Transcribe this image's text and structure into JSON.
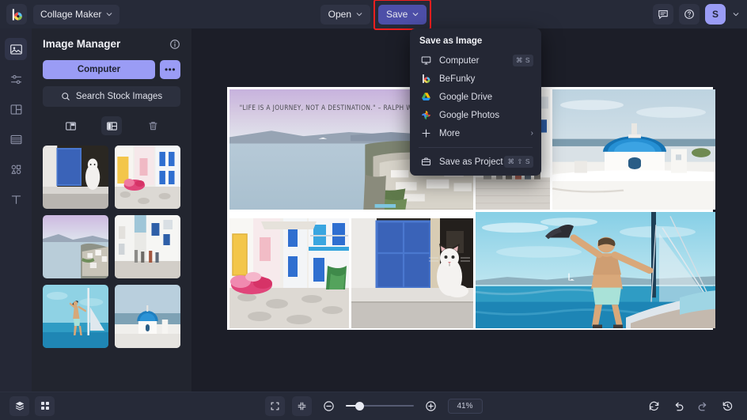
{
  "app": {
    "logo_icon": "befunky-logo-icon",
    "document_title": "Collage Maker",
    "title_chevron_icon": "chevron-down-icon"
  },
  "header": {
    "open_label": "Open",
    "open_chevron_icon": "chevron-down-icon",
    "save_label": "Save",
    "save_chevron_icon": "chevron-down-icon",
    "save_highlight_color": "#f01f1f",
    "save_button_color": "#4d4fa8",
    "feedback_icon": "chat-bubble-icon",
    "help_icon": "question-circle-icon",
    "avatar_initial": "S",
    "avatar_color": "#9a9cf5",
    "avatar_chevron_icon": "chevron-down-icon"
  },
  "save_menu": {
    "title": "Save as Image",
    "items": [
      {
        "label": "Computer",
        "icon": "monitor-icon",
        "shortcut": "⌘ S",
        "arrow": ""
      },
      {
        "label": "BeFunky",
        "icon": "befunky-logo-icon",
        "shortcut": "",
        "arrow": ""
      },
      {
        "label": "Google Drive",
        "icon": "google-drive-icon",
        "shortcut": "",
        "arrow": ""
      },
      {
        "label": "Google Photos",
        "icon": "google-photos-icon",
        "shortcut": "",
        "arrow": ""
      },
      {
        "label": "More",
        "icon": "plus-icon",
        "shortcut": "",
        "arrow": "›"
      }
    ],
    "project_item": {
      "label": "Save as Project",
      "icon": "briefcase-icon",
      "shortcut": "⌘ ⇧ S"
    }
  },
  "rail": {
    "items": [
      {
        "name": "image-manager",
        "icon": "image-icon",
        "active": true
      },
      {
        "name": "edit",
        "icon": "sliders-icon",
        "active": false
      },
      {
        "name": "layouts",
        "icon": "layout-icon",
        "active": false
      },
      {
        "name": "textures",
        "icon": "textures-icon",
        "active": false
      },
      {
        "name": "graphics",
        "icon": "shapes-icon",
        "active": false
      },
      {
        "name": "text",
        "icon": "text-t-icon",
        "active": false
      }
    ]
  },
  "panel": {
    "title": "Image Manager",
    "info_icon": "info-circle-icon",
    "computer_button": "Computer",
    "more_button": "•••",
    "search_placeholder": "Search Stock Images",
    "search_icon": "search-icon",
    "tools": [
      {
        "name": "fill-cells",
        "icon": "fill-cells-icon",
        "selected": false
      },
      {
        "name": "swap-cells",
        "icon": "swap-cells-icon",
        "selected": true
      },
      {
        "name": "delete-all",
        "icon": "trash-icon",
        "selected": false
      }
    ],
    "thumbnails": [
      {
        "name": "thumb-cat-doorway",
        "alt": "White cat in blue doorway"
      },
      {
        "name": "thumb-yellow-street",
        "alt": "Yellow street with flowers"
      },
      {
        "name": "thumb-coastline",
        "alt": "Santorini coastline at dusk"
      },
      {
        "name": "thumb-narrow-street",
        "alt": "Narrow whitewashed street"
      },
      {
        "name": "thumb-sailboat",
        "alt": "Man on sailboat"
      },
      {
        "name": "thumb-blue-dome",
        "alt": "Blue dome church by sea"
      }
    ]
  },
  "canvas": {
    "quote_text": "\"LIFE IS A JOURNEY, NOT A DESTINATION.\" – RALPH WALDO EMERSON",
    "cells": [
      {
        "name": "collage-cell-hero",
        "alt": "Santorini coastline at dusk with quote"
      },
      {
        "name": "collage-cell-street",
        "alt": "Narrow whitewashed street with people"
      },
      {
        "name": "collage-cell-dome",
        "alt": "Blue dome church overlooking sea"
      },
      {
        "name": "collage-cell-alley",
        "alt": "Colorful alley with flowers"
      },
      {
        "name": "collage-cell-cat",
        "alt": "White cat by blue shutters"
      },
      {
        "name": "collage-cell-boat",
        "alt": "Man standing on sailboat"
      }
    ]
  },
  "bottom": {
    "layers_icon": "layers-icon",
    "grid_icon": "grid-icon",
    "fullscreen_icon": "expand-icon",
    "fit_icon": "collapse-icon",
    "zoom_out_icon": "minus-circle-icon",
    "zoom_in_icon": "plus-circle-icon",
    "zoom_level": "41%",
    "reset_icon": "reset-icon",
    "undo_icon": "undo-icon",
    "redo_icon": "redo-icon",
    "history_icon": "history-icon"
  }
}
